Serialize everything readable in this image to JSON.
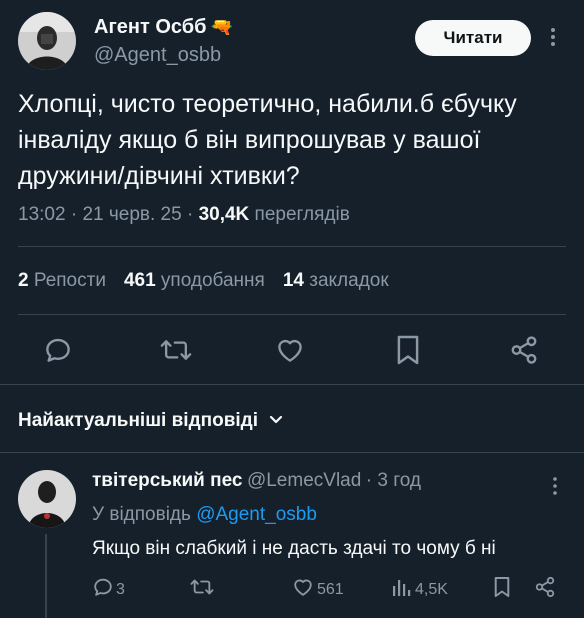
{
  "tweet": {
    "author_name": "Агент Осбб",
    "author_emoji": "🔫",
    "author_handle": "@Agent_osbb",
    "follow_label": "Читати",
    "text_lines": [
      "Хлопці, чисто теоретично, набили.б єбучку",
      "інваліду якщо б він випрошував у вашої",
      "дружини/дівчині хтивки?"
    ],
    "time": "13:02",
    "date": "21 черв. 25",
    "views_count": "30,4K",
    "views_label": "переглядів",
    "reposts_count": "2",
    "reposts_label": "Репости",
    "likes_count": "461",
    "likes_label": "уподобання",
    "bookmarks_count": "14",
    "bookmarks_label": "закладок"
  },
  "replies_section": {
    "sort_label": "Найактуальніші відповіді"
  },
  "reply": {
    "author_name": "твітерський пес",
    "author_handle": "@LemecVlad",
    "time_ago": "3 год",
    "reply_to_prefix": "У відповідь",
    "reply_to_handle": "@Agent_osbb",
    "text": "Якщо він слабкий і не дасть здачі то чому б ні",
    "reply_count": "3",
    "like_count": "561",
    "view_count": "4,5K"
  },
  "colors": {
    "background": "#15202b",
    "accent": "#1d9bf0",
    "muted": "#8b98a5"
  }
}
